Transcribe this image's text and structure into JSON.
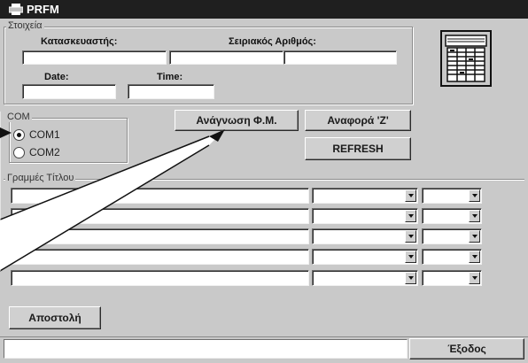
{
  "window": {
    "title": "PRFM"
  },
  "details": {
    "legend": "Στοιχεία",
    "manufacturer_label": "Κατασκευαστής:",
    "serial_label": "Σειριακός Αριθμός:",
    "date_label": "Date:",
    "time_label": "Time:",
    "manufacturer_value": "",
    "serial_value": "",
    "date_value": "",
    "time_value": ""
  },
  "com": {
    "legend": "COM",
    "options": [
      {
        "label": "COM1",
        "selected": true
      },
      {
        "label": "COM2",
        "selected": false
      }
    ]
  },
  "actions": {
    "read_label": "Ανάγνωση Φ.Μ.",
    "report_z_label": "Αναφορά 'Z'",
    "refresh_label": "REFRESH"
  },
  "title_lines": {
    "legend": "Γραμμές Τίτλου",
    "rows": [
      {
        "text": "",
        "option_1": "",
        "option_2": ""
      },
      {
        "text": "",
        "option_1": "",
        "option_2": ""
      },
      {
        "text": "",
        "option_1": "",
        "option_2": ""
      },
      {
        "text": "",
        "option_1": "",
        "option_2": ""
      },
      {
        "text": "",
        "option_1": "",
        "option_2": ""
      }
    ]
  },
  "send_label": "Αποστολή",
  "exit_label": "Έξοδος",
  "status_text": "",
  "icons": {
    "window_icon": "printer-icon",
    "device_icon": "cash-register-icon",
    "callout": "pointer-callout"
  },
  "colors": {
    "titlebar": "#1f1f1f",
    "window_bg": "#c9c9c9",
    "field_bg": "#ffffff"
  }
}
